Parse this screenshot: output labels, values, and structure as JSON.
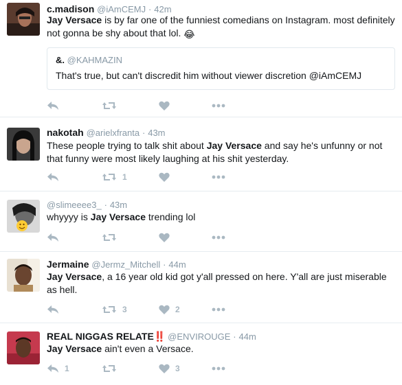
{
  "tweets": [
    {
      "name": "c.madison",
      "handle": "@iAmCEMJ",
      "sep": "·",
      "time": "42m",
      "text_bold": "Jay Versace",
      "text_rest": " is by far one of the funniest comedians on Instagram. most definitely not gonna be shy about that lol.",
      "emoji": "😂",
      "quote": {
        "name": "&.",
        "handle": "@KAHMAZIN",
        "text": "That's true, but can't discredit him without viewer discretion @iAmCEMJ"
      },
      "counts": {
        "reply": "",
        "retweet": "",
        "like": ""
      }
    },
    {
      "name": "nakotah",
      "handle": "@arielxfranta",
      "sep": "·",
      "time": "43m",
      "text_pre": "These people trying to talk shit about ",
      "text_bold": "Jay Versace",
      "text_rest": " and say he's unfunny or not that funny were most likely laughing at his shit yesterday.",
      "counts": {
        "reply": "",
        "retweet": "1",
        "like": ""
      }
    },
    {
      "name": "",
      "handle": "@slimeeee3_",
      "sep": "·",
      "time": "43m",
      "text_pre": "whyyyy is ",
      "text_bold": "Jay Versace",
      "text_rest": " trending lol",
      "counts": {
        "reply": "",
        "retweet": "",
        "like": ""
      }
    },
    {
      "name": "Jermaine",
      "handle": "@Jermz_Mitchell",
      "sep": "·",
      "time": "44m",
      "text_bold": "Jay Versace",
      "text_rest": ", a 16 year old kid got y'all pressed on here. Y'all are just miserable as hell.",
      "counts": {
        "reply": "",
        "retweet": "3",
        "like": "2"
      }
    },
    {
      "name": "REAL NIGGAS RELATE",
      "name_badge": "‼️",
      "handle": "@ENVIROUGE",
      "sep": "·",
      "time": "44m",
      "text_bold": "Jay Versace",
      "text_rest": " ain't even a Versace.",
      "counts": {
        "reply": "1",
        "retweet": "",
        "like": "3"
      }
    }
  ],
  "icons": {
    "reply": "reply-icon",
    "retweet": "retweet-icon",
    "like": "heart-icon",
    "more": "more-icon"
  },
  "colors": {
    "text": "#14171a",
    "muted": "#8899a6",
    "action": "#aab8c2",
    "divider": "#e6ecf0"
  }
}
